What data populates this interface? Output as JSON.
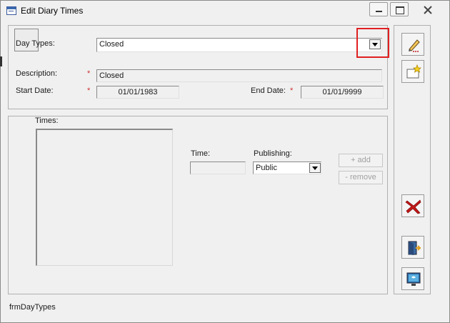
{
  "window": {
    "title": "Edit Diary Times",
    "icon": "form-icon",
    "controls": [
      "minimize-icon",
      "maximize-icon",
      "close-icon"
    ]
  },
  "day_types": {
    "label": "Day Types:",
    "value": "Closed"
  },
  "description": {
    "label": "Description:",
    "required_mark": "*",
    "value": "Closed"
  },
  "start_date": {
    "label": "Start Date:",
    "required_mark": "*",
    "value": "01/01/1983"
  },
  "end_date": {
    "label": "End Date:",
    "required_mark": "*",
    "value": "01/01/9999"
  },
  "times": {
    "label": "Times:",
    "time_label": "Time:",
    "time_value": "",
    "publishing_label": "Publishing:",
    "publishing_value": "Public",
    "add_label": "+ add",
    "remove_label": "- remove"
  },
  "toolbar": {
    "items": [
      "edit-pencil-icon",
      "new-record-icon",
      "delete-icon",
      "exit-door-icon",
      "help-monitor-icon"
    ]
  },
  "status": {
    "form_name": "frmDayTypes"
  },
  "colors": {
    "highlight": "#e02020",
    "required": "#d03030",
    "delete": "#c01818"
  }
}
